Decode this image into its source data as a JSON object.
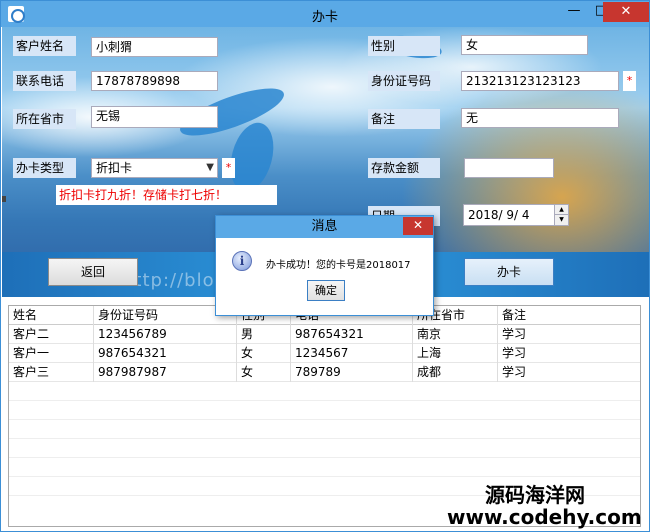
{
  "window": {
    "title": "办卡",
    "min": "—",
    "max": "□",
    "close": "✕"
  },
  "form": {
    "name_label": "客户姓名",
    "name_value": "小刺猬",
    "gender_label": "性别",
    "gender_value": "女",
    "phone_label": "联系电话",
    "phone_value": "17878789898",
    "id_label": "身份证号码",
    "id_value": "213213123123123",
    "city_label": "所在省市",
    "city_value": "无锡",
    "note_label": "备注",
    "note_value": "无",
    "card_type_label": "办卡类型",
    "card_type_value": "折扣卡",
    "deposit_label": "存款金额",
    "deposit_value": "",
    "date_label": "日期",
    "date_value": "2018/ 9/ 4",
    "hint": "折扣卡打九折！存储卡打七折！",
    "required_mark": "*"
  },
  "buttons": {
    "back": "返回",
    "submit": "办卡"
  },
  "table": {
    "headers": [
      "姓名",
      "身份证号码",
      "性别",
      "电话",
      "所在省市",
      "备注"
    ],
    "rows": [
      [
        "客户二",
        "123456789",
        "男",
        "987654321",
        "南京",
        "学习"
      ],
      [
        "客户一",
        "987654321",
        "女",
        "1234567",
        "上海",
        "学习"
      ],
      [
        "客户三",
        "987987987",
        "女",
        "789789",
        "成都",
        "学习"
      ]
    ]
  },
  "dialog": {
    "title": "消息",
    "icon": "i",
    "message": "办卡成功！您的卡号是2018017",
    "ok": "确定",
    "close": "✕"
  },
  "watermark": {
    "site_cn": "源码海洋网",
    "site_url": "www.codehy.com",
    "banner_text": "http://blog.csdn.net/..."
  }
}
